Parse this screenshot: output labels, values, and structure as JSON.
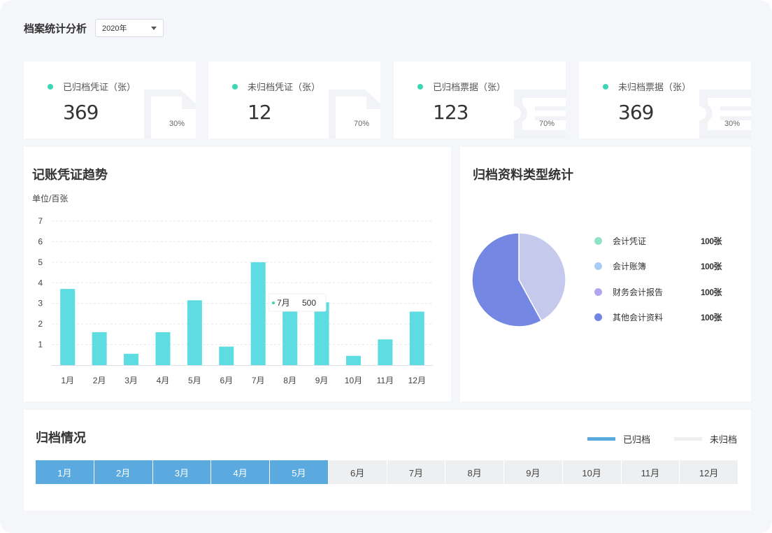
{
  "header": {
    "title": "档案统计分析",
    "year_value": "2020年"
  },
  "stats": [
    {
      "label": "已归档凭证（张）",
      "value": "369",
      "percent": "30%"
    },
    {
      "label": "未归档凭证（张）",
      "value": "12",
      "percent": "70%"
    },
    {
      "label": "已归档票据（张）",
      "value": "123",
      "percent": "70%"
    },
    {
      "label": "未归档票据（张）",
      "value": "369",
      "percent": "30%"
    }
  ],
  "trend": {
    "title": "记账凭证趋势",
    "unit": "单位/百张",
    "tooltip": {
      "month": "7月",
      "value": "500"
    }
  },
  "chart_data": {
    "type": "bar",
    "categories": [
      "1月",
      "2月",
      "3月",
      "4月",
      "5月",
      "6月",
      "7月",
      "8月",
      "9月",
      "10月",
      "11月",
      "12月"
    ],
    "values": [
      3.7,
      1.6,
      0.55,
      1.6,
      3.15,
      0.9,
      5.0,
      3.4,
      3.05,
      0.45,
      1.25,
      2.6
    ],
    "ylim": [
      0,
      7
    ],
    "yticks": [
      1,
      2,
      3,
      4,
      5,
      6,
      7
    ],
    "grid": true,
    "bar_color": "#5ddde2"
  },
  "types": {
    "title": "归档资料类型统计",
    "items": [
      {
        "name": "会计凭证",
        "value": "100张",
        "color": "#8de3c9"
      },
      {
        "name": "会计账簿",
        "value": "100张",
        "color": "#a8cdf5"
      },
      {
        "name": "财务会计报告",
        "value": "100张",
        "color": "#b1a6f0"
      },
      {
        "name": "其他会计资料",
        "value": "100张",
        "color": "#7186e2"
      }
    ],
    "pie": [
      {
        "share": 0.42,
        "color": "#c5c9ec"
      },
      {
        "share": 0.58,
        "color": "#7488e3"
      }
    ]
  },
  "archive": {
    "title": "归档情况",
    "legend_done": "已归档",
    "legend_todo": "未归档",
    "color_done": "#5aaadf",
    "color_todo": "#eeeff0",
    "months": [
      {
        "label": "1月",
        "archived": true
      },
      {
        "label": "2月",
        "archived": true
      },
      {
        "label": "3月",
        "archived": true
      },
      {
        "label": "4月",
        "archived": true
      },
      {
        "label": "5月",
        "archived": true
      },
      {
        "label": "6月",
        "archived": false
      },
      {
        "label": "7月",
        "archived": false
      },
      {
        "label": "8月",
        "archived": false
      },
      {
        "label": "9月",
        "archived": false
      },
      {
        "label": "10月",
        "archived": false
      },
      {
        "label": "11月",
        "archived": false
      },
      {
        "label": "12月",
        "archived": false
      }
    ]
  }
}
